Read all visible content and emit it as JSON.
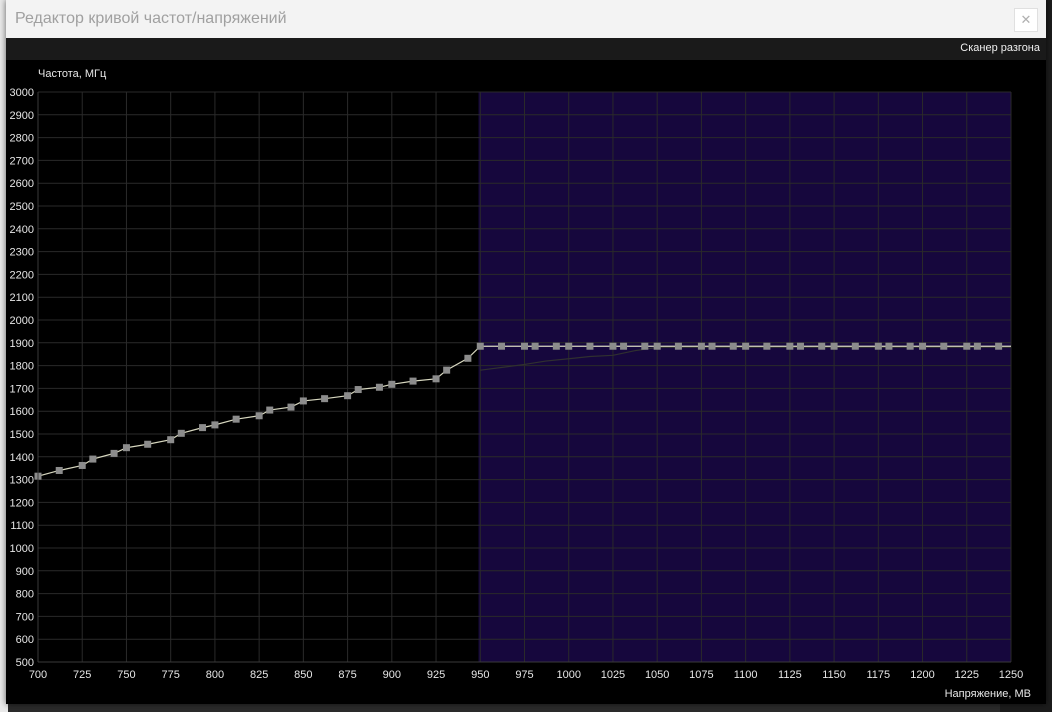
{
  "window": {
    "title": "Редактор кривой частот/напряжений",
    "close_glyph": "✕"
  },
  "toolbar": {
    "scanner_label": "Сканер разгона"
  },
  "colors": {
    "background": "#000000",
    "grid": "#2a2a2a",
    "selection": "#16073d",
    "curve": "#d8d8c0",
    "point": "#8c8c8c",
    "baseline_curve": "#303030"
  },
  "chart_data": {
    "type": "line",
    "xlabel": "Напряжение, МВ",
    "ylabel": "Частота, МГц",
    "xlim": [
      700,
      1250
    ],
    "ylim": [
      500,
      3000
    ],
    "x_ticks": [
      700,
      725,
      750,
      775,
      800,
      825,
      850,
      875,
      900,
      925,
      950,
      975,
      1000,
      1025,
      1050,
      1075,
      1100,
      1125,
      1150,
      1175,
      1200,
      1225,
      1250
    ],
    "y_ticks": [
      500,
      600,
      700,
      800,
      900,
      1000,
      1100,
      1200,
      1300,
      1400,
      1500,
      1600,
      1700,
      1800,
      1900,
      2000,
      2100,
      2200,
      2300,
      2400,
      2500,
      2600,
      2700,
      2800,
      2900,
      3000
    ],
    "grid": true,
    "selection_range": [
      949,
      1250
    ],
    "series": [
      {
        "points": [
          [
            700,
            1315
          ],
          [
            712,
            1340
          ],
          [
            725,
            1362
          ],
          [
            731,
            1390
          ],
          [
            743,
            1415
          ],
          [
            750,
            1440
          ],
          [
            762,
            1455
          ],
          [
            775,
            1475
          ],
          [
            781,
            1503
          ],
          [
            793,
            1528
          ],
          [
            800,
            1540
          ],
          [
            812,
            1565
          ],
          [
            825,
            1580
          ],
          [
            831,
            1605
          ],
          [
            843,
            1618
          ],
          [
            850,
            1645
          ],
          [
            862,
            1655
          ],
          [
            875,
            1668
          ],
          [
            881,
            1695
          ],
          [
            893,
            1705
          ],
          [
            900,
            1718
          ],
          [
            912,
            1732
          ],
          [
            925,
            1742
          ],
          [
            931,
            1780
          ],
          [
            943,
            1832
          ],
          [
            950,
            1885
          ],
          [
            962,
            1885
          ],
          [
            975,
            1885
          ],
          [
            981,
            1885
          ],
          [
            993,
            1885
          ],
          [
            1000,
            1885
          ],
          [
            1012,
            1885
          ],
          [
            1025,
            1885
          ],
          [
            1031,
            1885
          ],
          [
            1043,
            1885
          ],
          [
            1050,
            1885
          ],
          [
            1062,
            1885
          ],
          [
            1075,
            1885
          ],
          [
            1081,
            1885
          ],
          [
            1093,
            1885
          ],
          [
            1100,
            1885
          ],
          [
            1112,
            1885
          ],
          [
            1125,
            1885
          ],
          [
            1131,
            1885
          ],
          [
            1143,
            1885
          ],
          [
            1150,
            1885
          ],
          [
            1162,
            1885
          ],
          [
            1175,
            1885
          ],
          [
            1181,
            1885
          ],
          [
            1193,
            1885
          ],
          [
            1200,
            1885
          ],
          [
            1212,
            1885
          ],
          [
            1225,
            1885
          ],
          [
            1231,
            1885
          ],
          [
            1243,
            1885
          ]
        ]
      },
      {
        "points": [
          [
            950,
            1780
          ],
          [
            975,
            1805
          ],
          [
            987,
            1820
          ],
          [
            1000,
            1830
          ],
          [
            1012,
            1840
          ],
          [
            1025,
            1845
          ],
          [
            1037,
            1865
          ],
          [
            1050,
            1880
          ],
          [
            1250,
            1880
          ]
        ]
      }
    ]
  }
}
